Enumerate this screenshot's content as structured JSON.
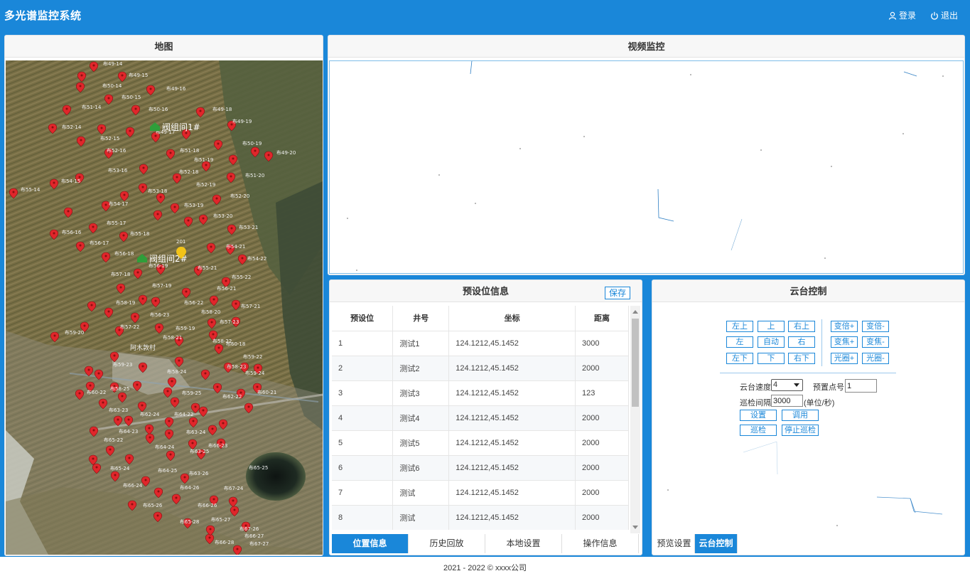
{
  "app": {
    "title": "多光谱监控系统",
    "login": "登录",
    "logout": "退出"
  },
  "map": {
    "title": "地图",
    "station_labels": [
      "阀组间1#",
      "阀组间2#"
    ],
    "marker_labels": [
      "布49-14",
      "布49-15",
      "布50-14",
      "布49-16",
      "布50-15",
      "布51-14",
      "布50-16",
      "布49-18",
      "布52-14",
      "布49-19",
      "布52-15",
      "布49-17",
      "布50-19",
      "布52-16",
      "布51-18",
      "布49-20",
      "布51-19",
      "布53-16",
      "布52-18",
      "布51-20",
      "布54-15",
      "布52-19",
      "布55-14",
      "布53-18",
      "布52-20",
      "布54-17",
      "布53-19",
      "布53-20",
      "布55-17",
      "布53-21",
      "布56-16",
      "布55-18",
      "布56-17",
      "布54-21",
      "布56-18",
      "布54-22",
      "布56-19",
      "布55-21",
      "布57-18",
      "布55-22",
      "布57-19",
      "布56-21",
      "布58-19",
      "布56-22",
      "布57-21",
      "布56-23",
      "布58-20",
      "布57-22",
      "布59-19",
      "布57-23",
      "布59-20",
      "布58-21",
      "布60-18",
      "布58-22",
      "布59-22",
      "布58-23",
      "布59-23",
      "布58-24",
      "布59-24",
      "布58-25",
      "布60-21",
      "布60-22",
      "布59-25",
      "布62-22",
      "布63-23",
      "布62-24",
      "布64-22",
      "布64-23",
      "布63-24",
      "布65-22",
      "布64-24",
      "布63-25",
      "布66-23",
      "布65-24",
      "布64-25",
      "布63-26",
      "布65-25",
      "布66-24",
      "布64-26",
      "布67-24",
      "布65-26",
      "布66-26",
      "布65-27",
      "布67-26",
      "布66-27",
      "布65-28",
      "布66-28",
      "布67-27",
      "201"
    ],
    "place_label": "阿木敦村"
  },
  "video": {
    "title": "视频监控"
  },
  "preset": {
    "title": "预设位信息",
    "save_label": "保存",
    "columns": [
      "预设位",
      "井号",
      "坐标",
      "距离"
    ],
    "rows": [
      [
        "1",
        "测试1",
        "124.1212,45.1452",
        "3000"
      ],
      [
        "2",
        "测试2",
        "124.1212,45.1452",
        "2000"
      ],
      [
        "3",
        "测试3",
        "124.1212,45.1452",
        "123"
      ],
      [
        "4",
        "测试4",
        "124.1212,45.1452",
        "2000"
      ],
      [
        "5",
        "测试5",
        "124.1212,45.1452",
        "2000"
      ],
      [
        "6",
        "测试6",
        "124.1212,45.1452",
        "2000"
      ],
      [
        "7",
        "测试",
        "124.1212,45.1452",
        "2000"
      ],
      [
        "8",
        "测试",
        "124.1212,45.1452",
        "2000"
      ]
    ],
    "tabs": [
      "位置信息",
      "历史回放",
      "本地设置",
      "操作信息"
    ],
    "active_tab": "位置信息"
  },
  "ptz": {
    "title": "云台控制",
    "dir_buttons": [
      [
        "左上",
        "上",
        "右上"
      ],
      [
        "左",
        "自动",
        "右"
      ],
      [
        "左下",
        "下",
        "右下"
      ]
    ],
    "lens_buttons": [
      [
        "变倍+",
        "变倍-"
      ],
      [
        "变焦+",
        "变焦-"
      ],
      [
        "光圈+",
        "光圈-"
      ]
    ],
    "speed_label": "云台速度",
    "speed_value": "4",
    "preset_no_label": "预置点号",
    "preset_no_value": "1",
    "patrol_interval_label": "巡检间隔",
    "patrol_interval_value": "3000",
    "patrol_unit": "(单位/秒)",
    "set_label": "设置",
    "call_label": "调用",
    "patrol_label": "巡检",
    "stop_patrol_label": "停止巡检",
    "tabs": [
      "预览设置",
      "云台控制"
    ],
    "active_tab": "云台控制"
  },
  "footer": {
    "text": "2021 - 2022 © xxxx公司"
  },
  "colors": {
    "primary": "#1a87d9",
    "marker": "#e0262b",
    "station": "#2f9e3a"
  }
}
